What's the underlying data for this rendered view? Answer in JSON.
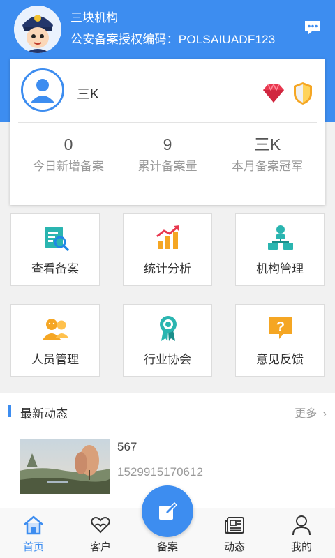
{
  "header": {
    "org_name": "三块机构",
    "org_code": "公安备案授权编码：POLSAIUADF123",
    "bg_color": "#3d8df0",
    "icons": {
      "avatar": "police-avatar",
      "message": "chat-bubble-icon"
    }
  },
  "profile": {
    "name": "三K",
    "badges": [
      "gem-icon",
      "shield-icon"
    ],
    "stats": [
      {
        "value": "0",
        "label": "今日新增备案"
      },
      {
        "value": "9",
        "label": "累计备案量"
      },
      {
        "value": "三K",
        "label": "本月备案冠军"
      }
    ]
  },
  "menu": [
    {
      "label": "查看备案",
      "icon": "document-search-icon"
    },
    {
      "label": "统计分析",
      "icon": "bar-chart-icon"
    },
    {
      "label": "机构管理",
      "icon": "org-structure-icon"
    },
    {
      "label": "人员管理",
      "icon": "people-icon"
    },
    {
      "label": "行业协会",
      "icon": "award-ribbon-icon"
    },
    {
      "label": "意见反馈",
      "icon": "question-feedback-icon"
    }
  ],
  "news": {
    "title": "最新动态",
    "more": "更多",
    "items": [
      {
        "title": "567",
        "time": "1529915170612",
        "thumb": "landscape-thumbnail"
      }
    ]
  },
  "tabbar": {
    "tabs": [
      {
        "label": "首页",
        "icon": "home-icon",
        "active": true
      },
      {
        "label": "客户",
        "icon": "heart-hands-icon",
        "active": false
      },
      {
        "label": "备案",
        "icon": "edit-icon",
        "active": false
      },
      {
        "label": "动态",
        "icon": "news-icon",
        "active": false
      },
      {
        "label": "我的",
        "icon": "person-icon",
        "active": false
      }
    ]
  }
}
